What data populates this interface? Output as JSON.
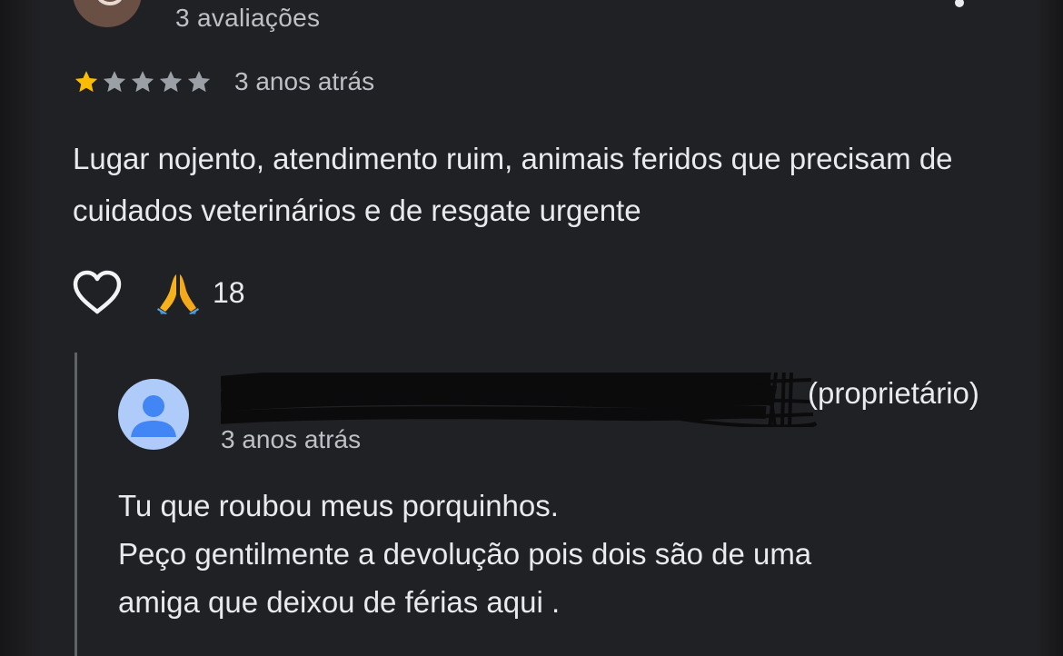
{
  "review": {
    "reviewer_reviews_count": "3 avaliações",
    "rating": 1,
    "rating_max": 5,
    "age": "3 anos atrás",
    "text": "Lugar nojento, atendimento ruim, animais feridos que precisam de cuidados veterinários e de resgate urgente",
    "reactions": {
      "like_icon": "heart-outline-icon",
      "reaction_icon": "folded-hands-emoji",
      "reaction_count": "18"
    }
  },
  "owner_reply": {
    "owner_tag": "(proprietário)",
    "age": "3 anos atrás",
    "text_lines": [
      "Tu que roubou meus porquinhos.",
      "Peço gentilmente a devolução pois dois são de uma",
      "amiga que deixou de férias aqui ."
    ]
  },
  "colors": {
    "background": "#202124",
    "star_filled": "#fbbc04",
    "star_empty": "#9aa0a6",
    "secondary_text": "#bdc1c6",
    "owner_avatar_bg": "#aecbfa",
    "owner_avatar_fg": "#4285f4"
  }
}
